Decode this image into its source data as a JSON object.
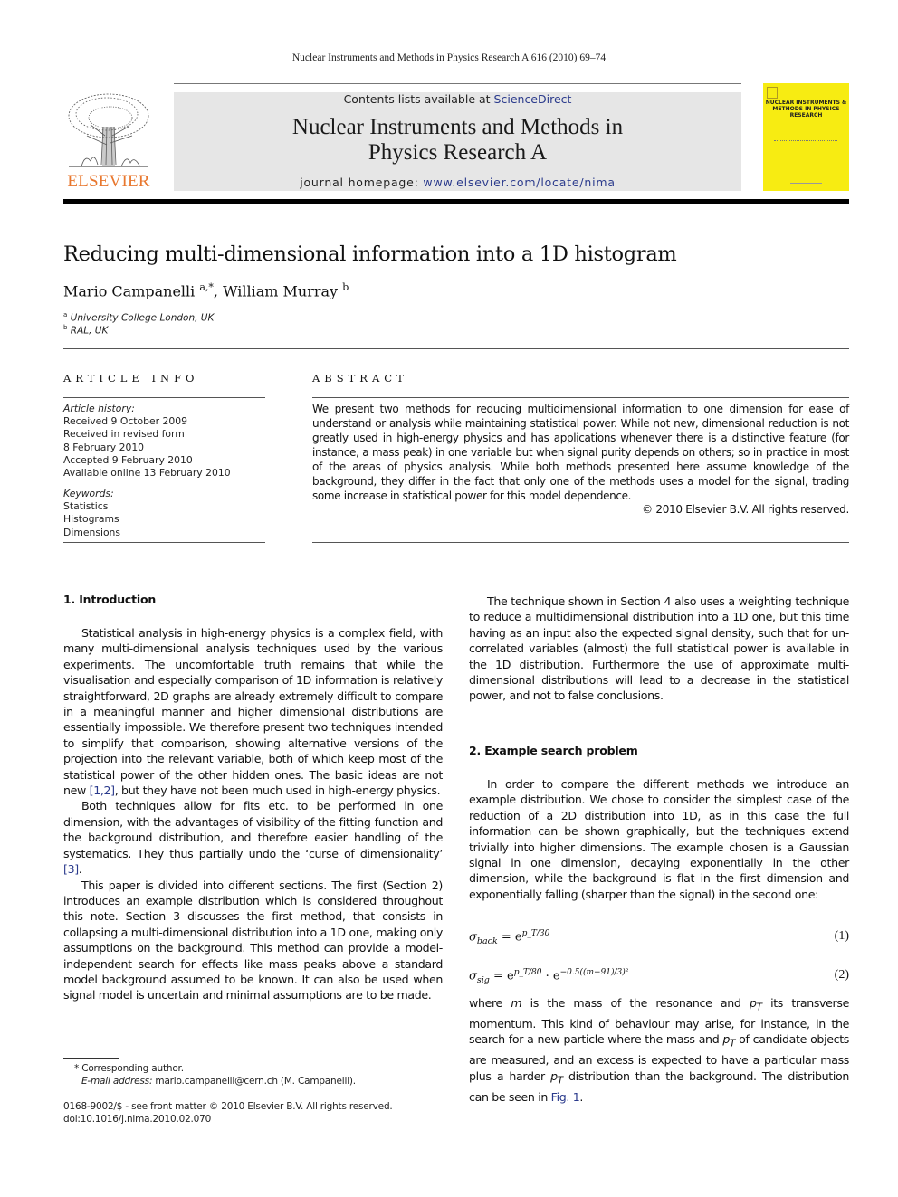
{
  "running_head": "Nuclear Instruments and Methods in Physics Research A 616 (2010) 69–74",
  "masthead": {
    "publisher_logo_icon": "elsevier-tree-icon",
    "publisher_name": "ELSEVIER",
    "contents_prefix": "Contents lists available at ",
    "contents_link": "ScienceDirect",
    "journal_title_line1": "Nuclear Instruments and Methods in",
    "journal_title_line2": "Physics Research A",
    "homepage_prefix": "journal homepage: ",
    "homepage_link": "www.elsevier.com/locate/nima",
    "cover_title": "NUCLEAR INSTRUMENTS & METHODS IN PHYSICS RESEARCH",
    "cover_color": "#f7ec12",
    "publisher_color": "#e8772e",
    "link_color": "#2a3a8c"
  },
  "article": {
    "title": "Reducing multi-dimensional information into a 1D histogram",
    "authors": [
      {
        "name": "Mario Campanelli",
        "sup": "a,*"
      },
      {
        "name": "William Murray",
        "sup": "b"
      }
    ],
    "author_separator": ", ",
    "affiliations": [
      {
        "sup": "a",
        "text": "University College London, UK"
      },
      {
        "sup": "b",
        "text": "RAL, UK"
      }
    ]
  },
  "article_info": {
    "heading": "ARTICLE INFO",
    "history_label": "Article history:",
    "history": [
      "Received 9 October 2009",
      "Received in revised form",
      "8 February 2010",
      "Accepted 9 February 2010",
      "Available online 13 February 2010"
    ],
    "keywords_label": "Keywords:",
    "keywords": [
      "Statistics",
      "Histograms",
      "Dimensions"
    ]
  },
  "abstract": {
    "heading": "ABSTRACT",
    "text": "We present two methods for reducing multidimensional information to one dimension for ease of understand or analysis while maintaining statistical power. While not new, dimensional reduction is not greatly used in high-energy physics and has applications whenever there is a distinctive feature (for instance, a mass peak) in one variable but when signal purity depends on others; so in practice in most of the areas of physics analysis. While both methods presented here assume knowledge of the background, they differ in the fact that only one of the methods uses a model for the signal, trading some increase in statistical power for this model dependence.",
    "copyright": "© 2010 Elsevier B.V. All rights reserved."
  },
  "sections": {
    "intro": {
      "heading": "1.  Introduction",
      "p1_a": "Statistical analysis in high-energy physics is a complex field, with many multi-dimensional analysis techniques used by the various experiments. The uncomfortable truth remains that while the visualisation and especially comparison of 1D information is relatively straightforward, 2D graphs are already extremely difficult to compare in a meaningful manner and higher dimensional distributions are essentially impossible. We therefore present two techniques intended to simplify that comparison, showing alternative versions of the projection into the relevant variable, both of which keep most of the statistical power of the other hidden ones. The basic ideas are not new ",
      "p1_ref": "[1,2]",
      "p1_b": ", but they have not been much used in high-energy physics.",
      "p2_a": "Both techniques allow for fits etc. to be performed in one dimension, with the advantages of visibility of the fitting function and the background distribution, and therefore easier handling of the systematics. They thus partially undo the ‘curse of dimensionality’ ",
      "p2_ref": "[3]",
      "p2_b": ".",
      "p3": "This paper is divided into different sections. The first (Section 2) introduces an example distribution which is considered throughout this note. Section 3 discusses the first method, that consists in collapsing a multi-dimensional distribution into a 1D one, making only assumptions on the background. This method can provide a model-independent search for effects like mass peaks above a standard model background assumed to be known. It can also be used when signal model is uncertain and minimal assumptions are to be made.",
      "p4": "The technique shown in Section 4 also uses a weighting technique to reduce a multidimensional distribution into a 1D one, but this time having as an input also the expected signal density, such that for un-correlated variables (almost) the full statistical power is available in the 1D distribution. Furthermore the use of approximate multi-dimensional distributions will lead to a decrease in the statistical power, and not to false conclusions."
    },
    "example": {
      "heading": "2.  Example search problem",
      "p1": "In order to compare the different methods we introduce an example distribution. We chose to consider the simplest case of the reduction of a 2D distribution into 1D, as in this case the full information can be shown graphically, but the techniques extend trivially into higher dimensions. The example chosen is a Gaussian signal in one dimension, decaying exponentially in the other dimension, while the background is flat in the first dimension and exponentially falling (sharper than the signal) in the second one:",
      "eq1": {
        "sigma": "σ",
        "sub": "back",
        "eq": " = e",
        "exp": "p_T/30",
        "number": "(1)"
      },
      "eq2": {
        "sigma": "σ",
        "sub": "sig",
        "eq": " = e",
        "exp1": "p_T/80",
        "dot": " · e",
        "exp2": "−0.5((m−91)/3)²",
        "number": "(2)"
      },
      "p2_a": "where ",
      "p2_m": "m",
      "p2_b": " is the mass of the resonance and ",
      "p2_pt": "p",
      "p2_pt_sub": "T",
      "p2_c": " its transverse momentum. This kind of behaviour may arise, for instance, in the search for a new particle where the mass and ",
      "p2_d": " of candidate objects are measured, and an excess is expected to have a particular mass plus a harder ",
      "p2_e": " distribution than the background. The distribution can be seen in ",
      "p2_ref": "Fig. 1",
      "p2_f": "."
    }
  },
  "footnotes": {
    "corresponding": "* Corresponding author.",
    "email_label": "E-mail address:",
    "email": " mario.campanelli@cern.ch (M. Campanelli).",
    "issn_line": "0168-9002/$ - see front matter © 2010 Elsevier B.V. All rights reserved.",
    "doi": "doi:10.1016/j.nima.2010.02.070"
  }
}
